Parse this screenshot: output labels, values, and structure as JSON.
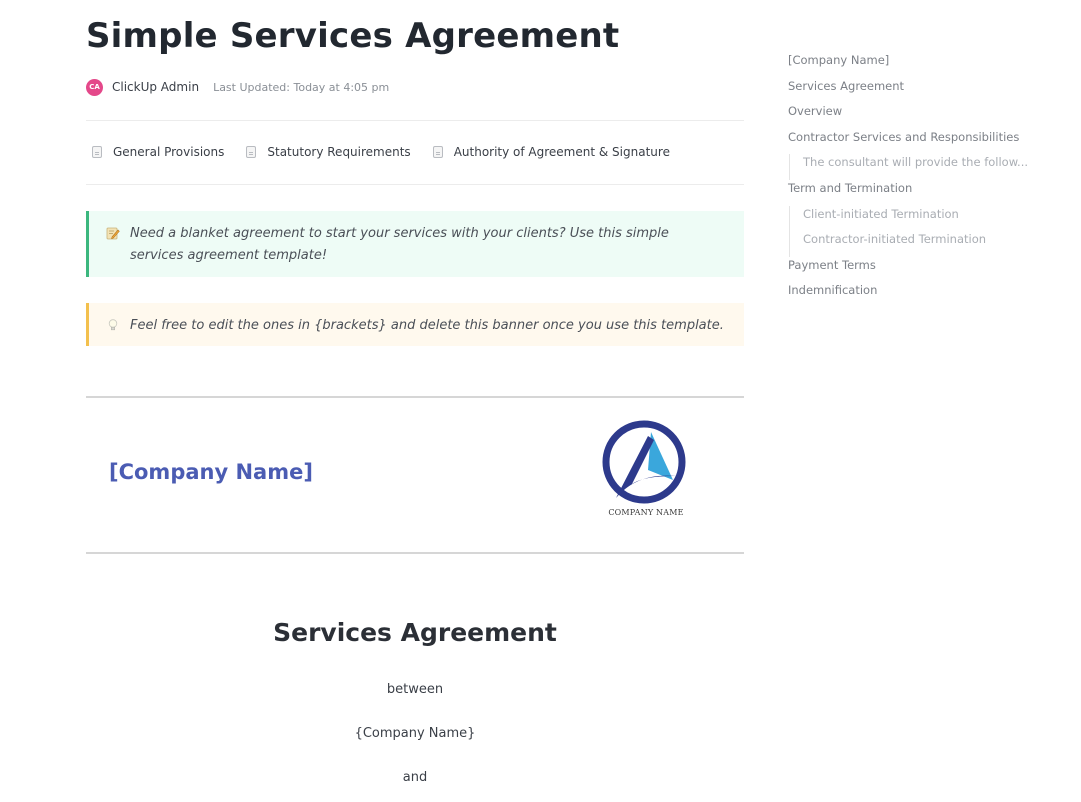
{
  "doc": {
    "title": "Simple Services Agreement",
    "author": {
      "initials": "CA",
      "name": "ClickUp Admin",
      "avatar_color": "#e4488a"
    },
    "last_updated": "Last Updated: Today at 4:05 pm",
    "subpages": [
      {
        "icon": "page-icon",
        "label": "General Provisions"
      },
      {
        "icon": "page-icon",
        "label": "Statutory Requirements"
      },
      {
        "icon": "page-icon",
        "label": "Authority of Agreement & Signature"
      }
    ],
    "callouts": [
      {
        "icon": "memo-pencil-icon",
        "text": "Need a blanket agreement to start your services with your clients? Use this simple services agreement template!",
        "accent": "#3bb77e",
        "background": "#eefcf6"
      },
      {
        "icon": "lightbulb-icon",
        "text": "Feel free to edit the ones in {brackets} and delete this banner once you use this template.",
        "accent": "#f3c04d",
        "background": "#fff9ee"
      }
    ],
    "company_heading": "[Company Name]",
    "company_heading_color": "#4b5cb3",
    "logo": {
      "caption": "COMPANY NAME",
      "ring_color": "#2d3a8c",
      "accent_color": "#3aa7dc"
    },
    "agreement": {
      "title": "Services Agreement",
      "lines": [
        "between",
        "{Company Name}",
        "and"
      ]
    }
  },
  "toc": {
    "items": [
      {
        "label": "[Company Name]",
        "level": 1
      },
      {
        "label": "Services Agreement",
        "level": 1
      },
      {
        "label": "Overview",
        "level": 1
      },
      {
        "label": "Contractor Services and Responsibilities",
        "level": 1
      },
      {
        "label": "The consultant will provide the follow...",
        "level": 2
      },
      {
        "label": "Term and Termination",
        "level": 1
      },
      {
        "label": "Client-initiated Termination",
        "level": 2
      },
      {
        "label": "Contractor-initiated Termination",
        "level": 2
      },
      {
        "label": "Payment Terms",
        "level": 1
      },
      {
        "label": "Indemnification",
        "level": 1
      }
    ]
  }
}
